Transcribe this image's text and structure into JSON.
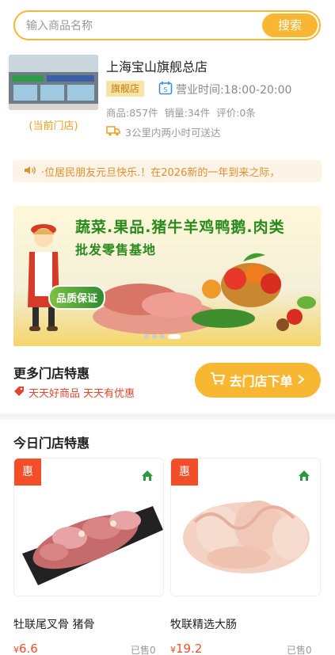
{
  "search": {
    "placeholder": "输入商品名称",
    "button_label": "搜索"
  },
  "store": {
    "current_label": "(当前门店)",
    "name": "上海宝山旗舰总店",
    "tag": "旗舰店",
    "hours": "营业时间:18:00-20:00",
    "products": "商品:857件",
    "sales": "销量:34件",
    "reviews": "评价:0条",
    "delivery": "3公里内两小时可送达"
  },
  "notice": {
    "text": "·位居民朋友元旦快乐.！在2026新的一年到来之际，"
  },
  "banner": {
    "title": "蔬菜.果品.猪牛羊鸡鸭鹅.肉类",
    "subtitle": "批发零售基地",
    "badge": "品质保证",
    "slide_count": 4,
    "active_slide": 4
  },
  "more_deals": {
    "title": "更多门店特惠",
    "subtitle": "天天好商品 天天有优惠",
    "button_label": "去门店下单"
  },
  "today": {
    "title": "今日门店特惠",
    "products": [
      {
        "tag": "惠",
        "name": "牡联尾叉骨 猪骨",
        "currency": "¥",
        "price": "6.6",
        "sold": "已售0"
      },
      {
        "tag": "惠",
        "name": "牧联精选大肠",
        "currency": "¥",
        "price": "19.2",
        "sold": "已售0"
      }
    ]
  },
  "colors": {
    "accent": "#f7b733",
    "deal_red": "#f24e2a",
    "notice": "#e0912f",
    "green": "#2a8a1e"
  }
}
